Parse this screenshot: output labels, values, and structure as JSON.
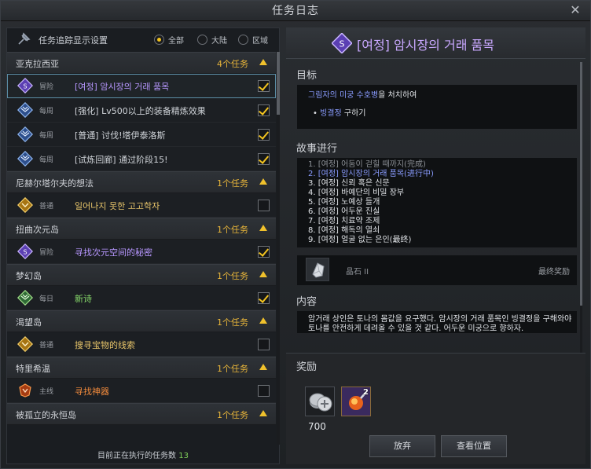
{
  "window": {
    "title": "任务日志",
    "close_icon": "close-icon"
  },
  "filter": {
    "settings_label": "任务追踪显示设置",
    "options": [
      {
        "label": "全部",
        "selected": true
      },
      {
        "label": "大陆",
        "selected": false
      },
      {
        "label": "区域",
        "selected": false
      }
    ]
  },
  "groups": [
    {
      "name": "亚克拉西亚",
      "count": "4个任务",
      "quests": [
        {
          "type": "冒险",
          "name": "[여정] 암시장의 거래 품목",
          "color": "#b797ff",
          "icon": "purple-shield-icon",
          "checked": true,
          "selected": true
        },
        {
          "type": "每周",
          "name": "[强化] Lv500以上的装备精炼效果",
          "color": "#cfd3d8",
          "icon": "blue-wing-icon",
          "checked": true,
          "selected": false
        },
        {
          "type": "每周",
          "name": "[普通] 讨伐!塔伊泰洛斯",
          "color": "#cfd3d8",
          "icon": "blue-wing-icon",
          "checked": true,
          "selected": false
        },
        {
          "type": "每周",
          "name": "[试炼回廊] 通过阶段15!",
          "color": "#cfd3d8",
          "icon": "blue-wing-icon",
          "checked": true,
          "selected": false
        }
      ]
    },
    {
      "name": "尼赫尔塔尔夫的想法",
      "count": "1个任务",
      "quests": [
        {
          "type": "普通",
          "name": "일어나지 못한 고고학자",
          "color": "#e8c56a",
          "icon": "yellow-diamond-icon",
          "checked": false,
          "selected": false
        }
      ]
    },
    {
      "name": "扭曲次元岛",
      "count": "1个任务",
      "quests": [
        {
          "type": "冒险",
          "name": "寻找次元空间的秘密",
          "color": "#b797ff",
          "icon": "purple-shield-icon",
          "checked": true,
          "selected": false
        }
      ]
    },
    {
      "name": "梦幻岛",
      "count": "1个任务",
      "quests": [
        {
          "type": "每日",
          "name": "新诗",
          "color": "#86d86a",
          "icon": "green-wing-icon",
          "checked": true,
          "selected": false
        }
      ]
    },
    {
      "name": "渴望岛",
      "count": "1个任务",
      "quests": [
        {
          "type": "普通",
          "name": "搜寻宝物的线索",
          "color": "#e8c56a",
          "icon": "yellow-diamond-icon",
          "checked": false,
          "selected": false
        }
      ]
    },
    {
      "name": "特里希温",
      "count": "1个任务",
      "quests": [
        {
          "type": "主线",
          "name": "寻找神器",
          "color": "#f08a3c",
          "icon": "orange-crest-icon",
          "checked": false,
          "selected": false
        }
      ]
    },
    {
      "name": "被孤立的永恒岛",
      "count": "1个任务",
      "quests": []
    }
  ],
  "footer": {
    "label": "目前正在执行的任务数",
    "count": "13"
  },
  "detail": {
    "title": "[여정] 암시장의 거래 품목",
    "goal_title": "目标",
    "goal_line1_hl": "그림자의 미궁 수호병",
    "goal_line1_rest": "을 처치하여",
    "goal_line2_bullet": "•",
    "goal_line2_hl": "빙결정",
    "goal_line2_rest": " 구하기",
    "story_title": "故事进行",
    "story": [
      {
        "text": "1. [여정] 어둠이 걷힐 때까지(完成)",
        "state": "done"
      },
      {
        "text": "2. [여정] 암시장의 거래 품목(进行中)",
        "state": "cur"
      },
      {
        "text": "3. [여정] 신뢰 혹은 신문",
        "state": "todo"
      },
      {
        "text": "4. [여정] 바예단의 비밀 장부",
        "state": "todo"
      },
      {
        "text": "5. [여정] 노예상 들개",
        "state": "todo"
      },
      {
        "text": "6. [여정] 어두운 진실",
        "state": "todo"
      },
      {
        "text": "7. [여정] 치료약 조제",
        "state": "todo"
      },
      {
        "text": "8. [여정] 해독의 열쇠",
        "state": "todo"
      },
      {
        "text": "9. [여정] 얼굴 없는 은인(最终)",
        "state": "todo"
      }
    ],
    "final_item_name": "晶石 II",
    "final_reward_label": "最终奖励",
    "content_title": "内容",
    "content_text": "암거래 상인은 토나의 몸값을 요구했다. 암시장의 거래 품목인 빙결정을 구해와야 토나를 안전하게 데려올 수 있을 것 같다. 어두운 미궁으로 향하자."
  },
  "reward": {
    "title": "奖励",
    "silver_amount": "700",
    "item2_count": "2",
    "abandon_label": "放弃",
    "locate_label": "查看位置"
  }
}
